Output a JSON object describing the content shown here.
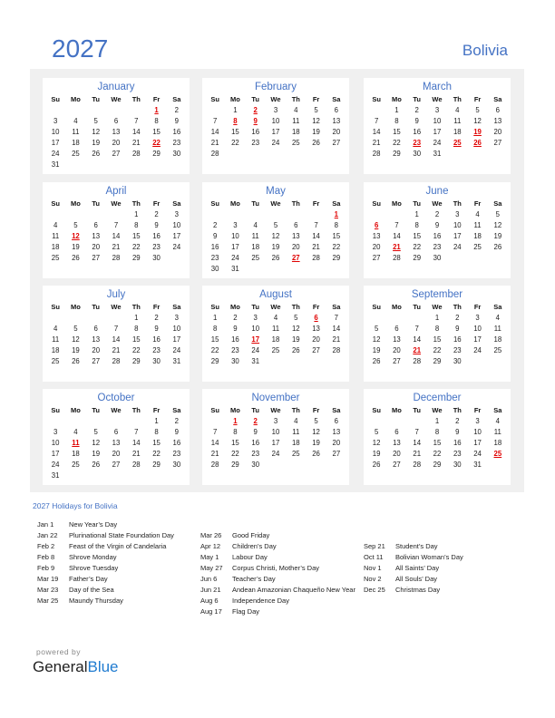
{
  "header": {
    "year": "2027",
    "country": "Bolivia"
  },
  "weekdays": [
    "Su",
    "Mo",
    "Tu",
    "We",
    "Th",
    "Fr",
    "Sa"
  ],
  "colors": {
    "accent": "#4472c4",
    "holiday": "#e00000",
    "panel": "#f0f0f0"
  },
  "months": [
    {
      "name": "January",
      "start": 5,
      "days": 31,
      "holidays": [
        1,
        22
      ]
    },
    {
      "name": "February",
      "start": 1,
      "days": 28,
      "holidays": [
        2,
        8,
        9
      ]
    },
    {
      "name": "March",
      "start": 1,
      "days": 31,
      "holidays": [
        19,
        23,
        25,
        26
      ]
    },
    {
      "name": "April",
      "start": 4,
      "days": 30,
      "holidays": [
        12
      ]
    },
    {
      "name": "May",
      "start": 6,
      "days": 31,
      "holidays": [
        1,
        27
      ]
    },
    {
      "name": "June",
      "start": 2,
      "days": 30,
      "holidays": [
        6,
        21
      ]
    },
    {
      "name": "July",
      "start": 4,
      "days": 31,
      "holidays": []
    },
    {
      "name": "August",
      "start": 0,
      "days": 31,
      "holidays": [
        6,
        17
      ]
    },
    {
      "name": "September",
      "start": 3,
      "days": 30,
      "holidays": [
        21
      ]
    },
    {
      "name": "October",
      "start": 5,
      "days": 31,
      "holidays": [
        11
      ]
    },
    {
      "name": "November",
      "start": 1,
      "days": 30,
      "holidays": [
        1,
        2
      ]
    },
    {
      "name": "December",
      "start": 3,
      "days": 31,
      "holidays": [
        25
      ]
    }
  ],
  "holidays_title": "2027 Holidays for Bolivia",
  "holiday_columns": [
    [
      {
        "date": "Jan 1",
        "name": "New Year’s Day"
      },
      {
        "date": "Jan 22",
        "name": "Plurinational State Foundation Day"
      },
      {
        "date": "Feb 2",
        "name": "Feast of the Virgin of Candelaria"
      },
      {
        "date": "Feb 8",
        "name": "Shrove Monday"
      },
      {
        "date": "Feb 9",
        "name": "Shrove Tuesday"
      },
      {
        "date": "Mar 19",
        "name": "Father’s Day"
      },
      {
        "date": "Mar 23",
        "name": "Day of the Sea"
      },
      {
        "date": "Mar 25",
        "name": "Maundy Thursday"
      }
    ],
    [
      {
        "date": "Mar 26",
        "name": "Good Friday"
      },
      {
        "date": "Apr 12",
        "name": "Children’s Day"
      },
      {
        "date": "May 1",
        "name": "Labour Day"
      },
      {
        "date": "May 27",
        "name": "Corpus Christi, Mother’s Day"
      },
      {
        "date": "Jun 6",
        "name": "Teacher’s Day"
      },
      {
        "date": "Jun 21",
        "name": "Andean Amazonian Chaqueño New Year"
      },
      {
        "date": "Aug 6",
        "name": "Independence Day"
      },
      {
        "date": "Aug 17",
        "name": "Flag Day"
      }
    ],
    [
      {
        "date": "Sep 21",
        "name": "Student’s Day"
      },
      {
        "date": "Oct 11",
        "name": "Bolivian Woman’s Day"
      },
      {
        "date": "Nov 1",
        "name": "All Saints’ Day"
      },
      {
        "date": "Nov 2",
        "name": "All Souls’ Day"
      },
      {
        "date": "Dec 25",
        "name": "Christmas Day"
      }
    ]
  ],
  "footer": {
    "powered_by": "powered by",
    "brand_general": "General",
    "brand_blue": "Blue"
  }
}
